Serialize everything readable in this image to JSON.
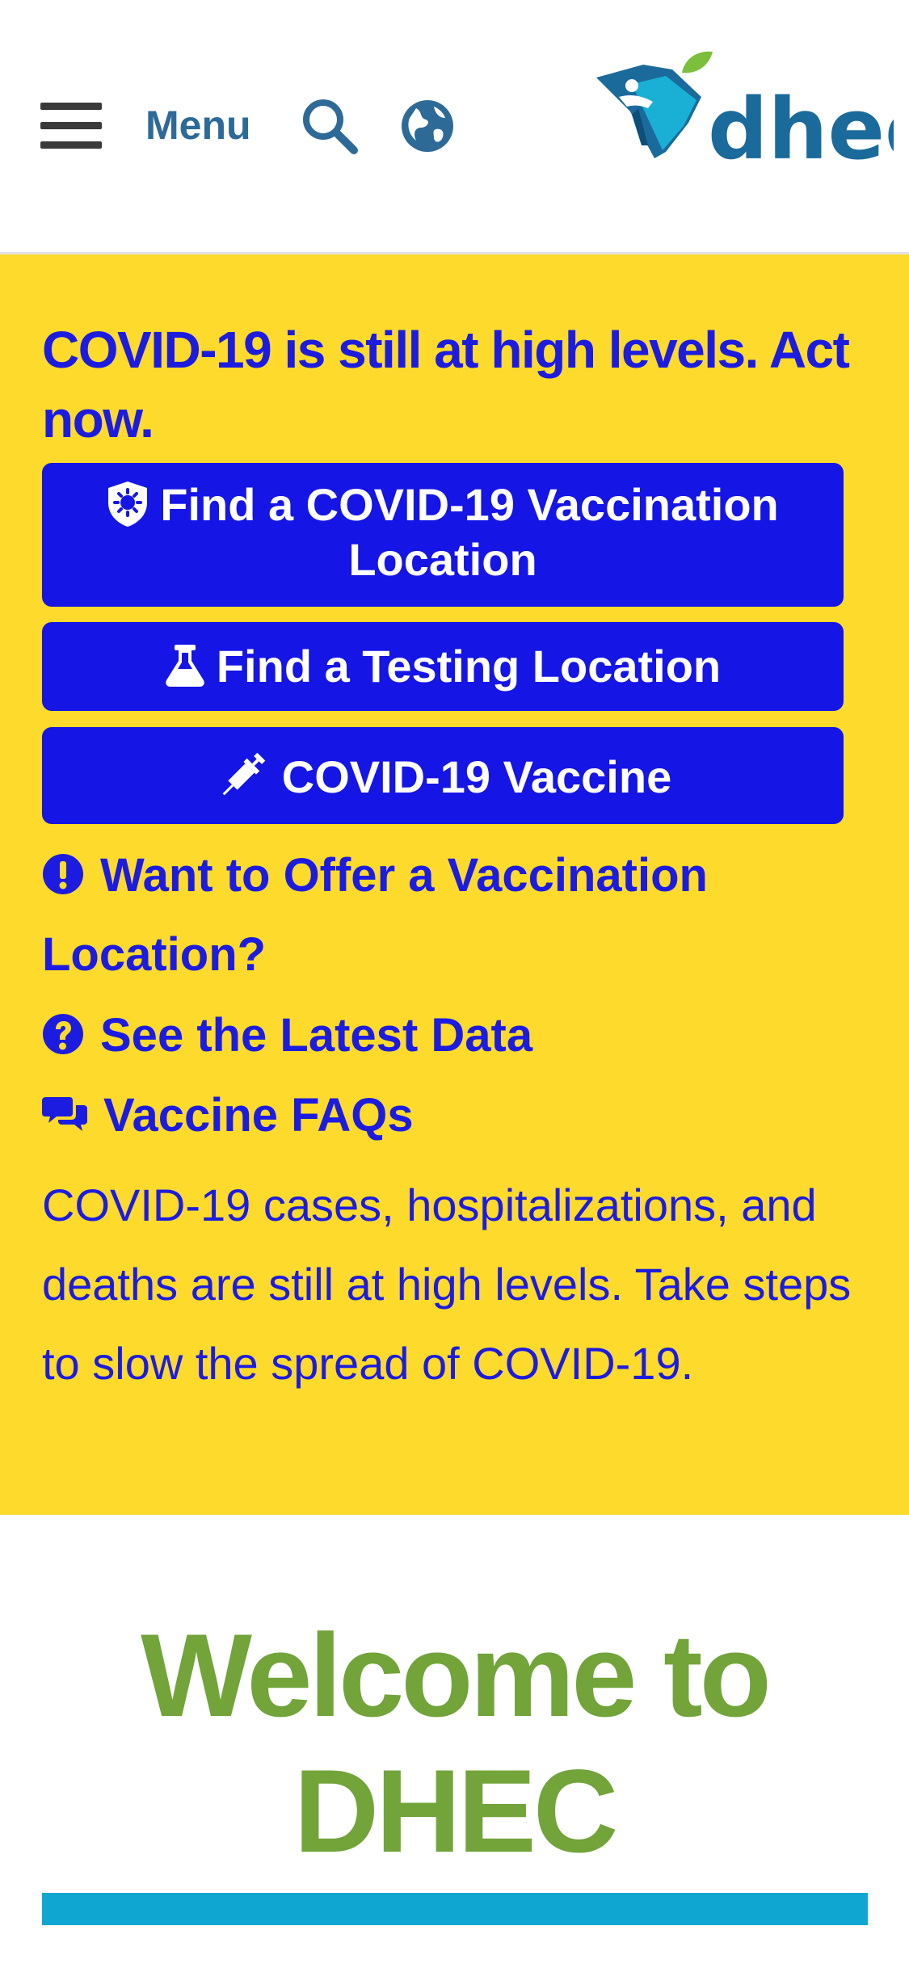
{
  "header": {
    "menu_label": "Menu",
    "logo_text": "dhec",
    "colors": {
      "menu_text": "#2e6a98",
      "logo_blue": "#1b6a9c",
      "logo_teal": "#1ab0d6",
      "logo_leaf": "#7bbf3c"
    }
  },
  "alert": {
    "heading": "COVID-19 is still at high levels. Act now.",
    "buttons": [
      {
        "icon": "shield-virus-icon",
        "label": "Find a COVID-19 Vaccination Location"
      },
      {
        "icon": "flask-icon",
        "label": "Find a Testing Location"
      },
      {
        "icon": "syringe-icon",
        "label": "COVID-19 Vaccine"
      }
    ],
    "links": [
      {
        "icon": "exclamation-circle-icon",
        "label": "Want to Offer a Vaccination Location?"
      },
      {
        "icon": "question-circle-icon",
        "label": "See the Latest Data"
      },
      {
        "icon": "comments-icon",
        "label": "Vaccine FAQs"
      }
    ],
    "body": "COVID-19 cases, hospitalizations, and deaths are still at high levels. Take steps to slow the spread of COVID-19.",
    "colors": {
      "background": "#fdda2c",
      "text": "#1c1ce0",
      "button": "#1515e6"
    }
  },
  "welcome": {
    "title": "Welcome to DHEC",
    "colors": {
      "title": "#72a43a",
      "bar": "#0fa7d1"
    }
  }
}
